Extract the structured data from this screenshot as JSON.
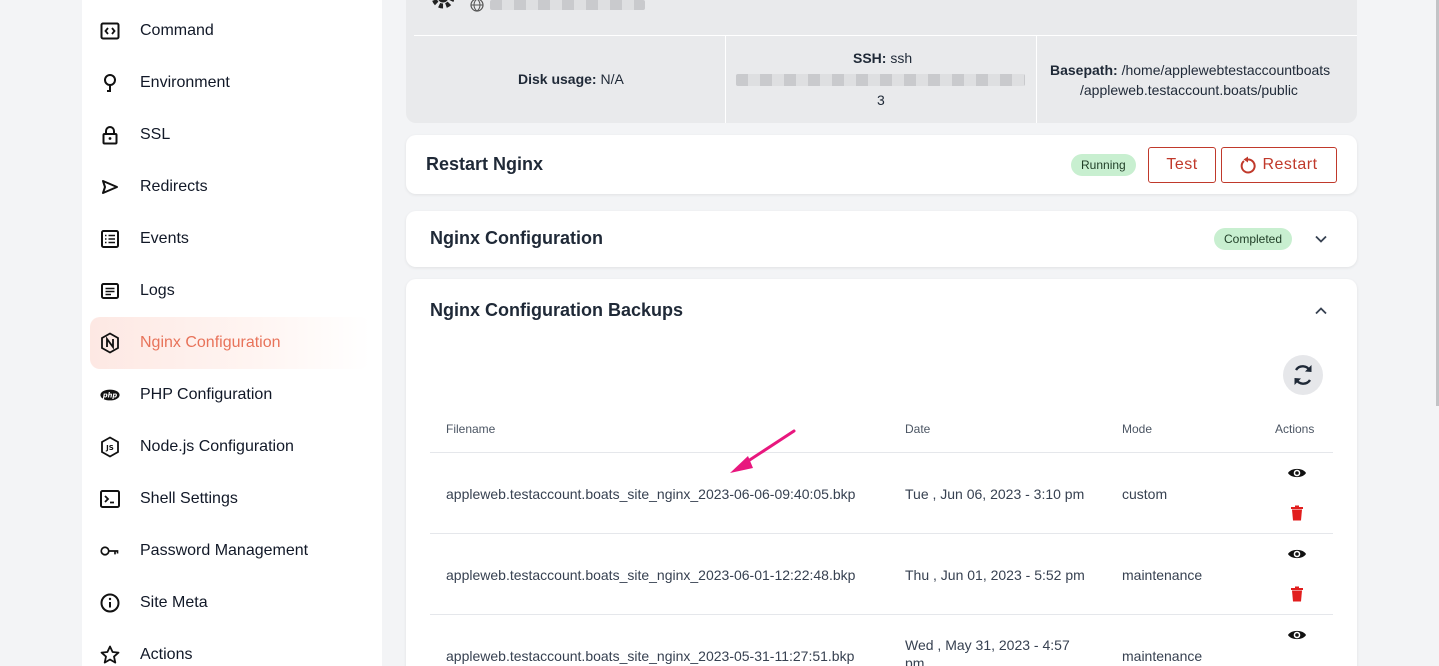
{
  "sidebar": {
    "items": [
      {
        "label": "Command",
        "icon": "code-icon"
      },
      {
        "label": "Environment",
        "icon": "pin-icon"
      },
      {
        "label": "SSL",
        "icon": "lock-icon"
      },
      {
        "label": "Redirects",
        "icon": "send-icon"
      },
      {
        "label": "Events",
        "icon": "list-icon"
      },
      {
        "label": "Logs",
        "icon": "log-icon"
      },
      {
        "label": "Nginx Configuration",
        "icon": "nginx-icon",
        "active": true
      },
      {
        "label": "PHP Configuration",
        "icon": "php-icon"
      },
      {
        "label": "Node.js Configuration",
        "icon": "nodejs-icon"
      },
      {
        "label": "Shell Settings",
        "icon": "terminal-icon"
      },
      {
        "label": "Password Management",
        "icon": "key-icon"
      },
      {
        "label": "Site Meta",
        "icon": "info-icon"
      },
      {
        "label": "Actions",
        "icon": "star-icon"
      }
    ],
    "active_color": "#e8735a"
  },
  "info": {
    "disk_label": "Disk usage:",
    "disk_value": "N/A",
    "ssh_label": "SSH:",
    "ssh_value": "ssh",
    "ssh_tail": "3",
    "basepath_label": "Basepath:",
    "basepath_line1": "/home/applewebtestaccountboats",
    "basepath_line2": "/appleweb.testaccount.boats/public"
  },
  "restart": {
    "title": "Restart Nginx",
    "status": "Running",
    "test_label": "Test",
    "restart_label": "Restart"
  },
  "nginx_config": {
    "title": "Nginx Configuration",
    "status": "Completed"
  },
  "backups": {
    "title": "Nginx Configuration Backups",
    "columns": [
      "Filename",
      "Date",
      "Mode",
      "Actions"
    ],
    "rows": [
      {
        "filename": "appleweb.testaccount.boats_site_nginx_2023-06-06-09:40:05.bkp",
        "date": "Tue , Jun 06, 2023 - 3:10 pm",
        "mode": "custom"
      },
      {
        "filename": "appleweb.testaccount.boats_site_nginx_2023-06-01-12:22:48.bkp",
        "date": "Thu , Jun 01, 2023 - 5:52 pm",
        "mode": "maintenance"
      },
      {
        "filename": "appleweb.testaccount.boats_site_nginx_2023-05-31-11:27:51.bkp",
        "date_line1": "Wed , May 31, 2023 - 4:57",
        "date_line2": "pm",
        "mode": "maintenance"
      }
    ]
  },
  "colors": {
    "accent": "#c0392b",
    "success_bg": "#c8efd0",
    "arrow": "#e8177e"
  }
}
